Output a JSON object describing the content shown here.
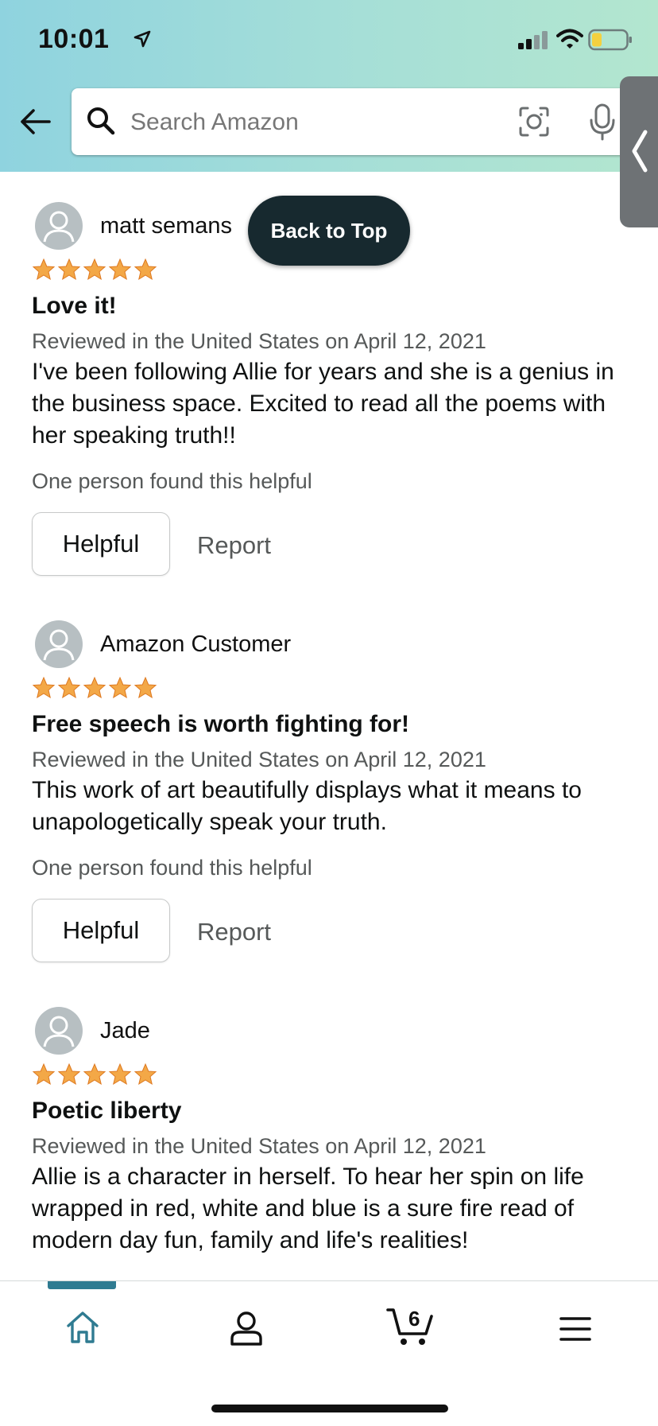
{
  "status_bar": {
    "time": "10:01"
  },
  "search": {
    "placeholder": "Search Amazon"
  },
  "back_to_top": "Back to Top",
  "reviews": [
    {
      "name": "matt semans",
      "stars": 5,
      "title": "Love it!",
      "date": "Reviewed in the United States on April 12, 2021",
      "body": "I've been following Allie for years and she is a genius in the business space. Excited to read all the poems with her speaking truth!!",
      "helpful_count": "One person found this helpful",
      "helpful_label": "Helpful",
      "report_label": "Report"
    },
    {
      "name": "Amazon Customer",
      "stars": 5,
      "title": "Free speech is worth fighting for!",
      "date": "Reviewed in the United States on April 12, 2021",
      "body": "This work of art beautifully displays what it means to unapologetically speak your truth.",
      "helpful_count": "One person found this helpful",
      "helpful_label": "Helpful",
      "report_label": "Report"
    },
    {
      "name": "Jade",
      "stars": 5,
      "title": "Poetic liberty",
      "date": "Reviewed in the United States on April 12, 2021",
      "body": "Allie is a character in herself. To hear her spin on life wrapped in red, white and blue is a sure fire read of modern day fun, family and life's realities!"
    }
  ],
  "bottom_nav": {
    "items": [
      "home-icon",
      "account-icon",
      "cart-icon",
      "menu-icon"
    ],
    "cart_count": "6",
    "active": "home"
  },
  "colors": {
    "star": "#f3a847",
    "accent": "#2f7b91",
    "back_to_top_bg": "#17292f"
  }
}
